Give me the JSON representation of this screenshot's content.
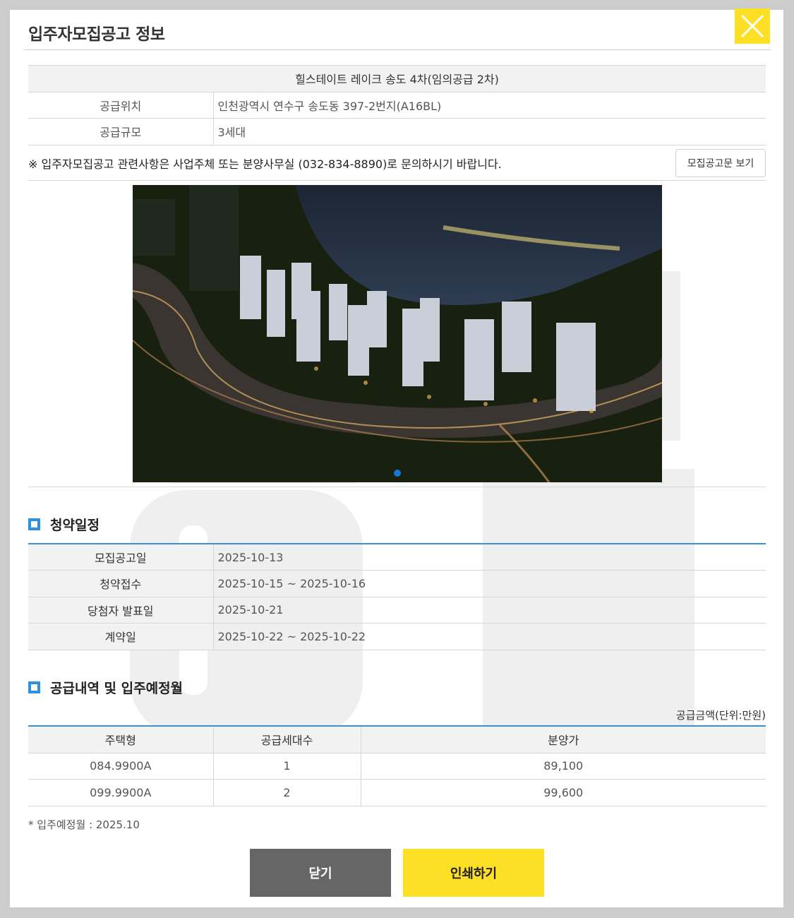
{
  "modal": {
    "title": "입주자모집공고 정보",
    "close_icon": "close-x-icon",
    "accent_color": "#fde025"
  },
  "info": {
    "title": "힐스테이트 레이크 송도 4차(임의공급 2차)",
    "rows": [
      {
        "label": "공급위치",
        "value": "인천광역시 연수구 송도동 397-2번지(A16BL)"
      },
      {
        "label": "공급규모",
        "value": "3세대"
      }
    ],
    "notice": "※ 입주자모집공고 관련사항은 사업주체 또는 분양사무실 (032-834-8890)로 문의하시기 바랍니다.",
    "view_button": "모집공고문 보기"
  },
  "schedule": {
    "title": "청약일정",
    "rows": [
      {
        "label": "모집공고일",
        "value": "2025-10-13"
      },
      {
        "label": "청약접수",
        "value": "2025-10-15 ~ 2025-10-16"
      },
      {
        "label": "당첨자 발표일",
        "value": "2025-10-21"
      },
      {
        "label": "계약일",
        "value": "2025-10-22 ~ 2025-10-22"
      }
    ]
  },
  "supply": {
    "title": "공급내역 및 입주예정월",
    "unit_note": "공급금액(단위:만원)",
    "headers": [
      "주택형",
      "공급세대수",
      "분양가"
    ],
    "rows": [
      [
        "084.9900A",
        "1",
        "89,100"
      ],
      [
        "099.9900A",
        "2",
        "99,600"
      ]
    ],
    "move_in": "* 입주예정월 : 2025.10"
  },
  "buttons": {
    "close": "닫기",
    "print": "인쇄하기"
  }
}
